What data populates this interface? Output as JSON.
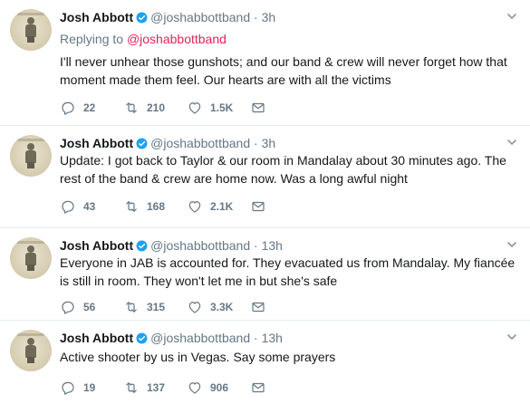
{
  "tweets": [
    {
      "name": "Josh Abbott",
      "handle": "@joshabbottband",
      "dot": "·",
      "time": "3h",
      "reply_prefix": "Replying to",
      "reply_handle": "@joshabbottband",
      "text": "I'll never unhear those gunshots; and our band & crew will never forget how that moment made them feel. Our hearts are with all the victims",
      "replies": "22",
      "retweets": "210",
      "likes": "1.5K"
    },
    {
      "name": "Josh Abbott",
      "handle": "@joshabbottband",
      "dot": "·",
      "time": "3h",
      "text": "Update: I got back to Taylor & our room in Mandalay about 30 minutes ago. The rest of the band & crew are home now. Was a long awful night",
      "replies": "43",
      "retweets": "168",
      "likes": "2.1K"
    },
    {
      "name": "Josh Abbott",
      "handle": "@joshabbottband",
      "dot": "·",
      "time": "13h",
      "text": "Everyone in JAB is accounted for. They evacuated us from Mandalay. My fiancée is still in room. They won't let me in but she's safe",
      "replies": "56",
      "retweets": "315",
      "likes": "3.3K"
    },
    {
      "name": "Josh Abbott",
      "handle": "@joshabbottband",
      "dot": "·",
      "time": "13h",
      "text": "Active shooter by us in Vegas. Say some prayers",
      "replies": "19",
      "retweets": "137",
      "likes": "906"
    }
  ],
  "icons": {
    "verified": "verified-badge-icon",
    "reply": "reply-icon",
    "retweet": "retweet-icon",
    "like": "heart-icon",
    "dm": "direct-message-icon",
    "more": "chevron-down-icon"
  },
  "colors": {
    "text": "#14171a",
    "muted": "#657786",
    "reply_link": "#e0245e",
    "verified": "#1da1f2",
    "divider": "#e6ecf0"
  }
}
